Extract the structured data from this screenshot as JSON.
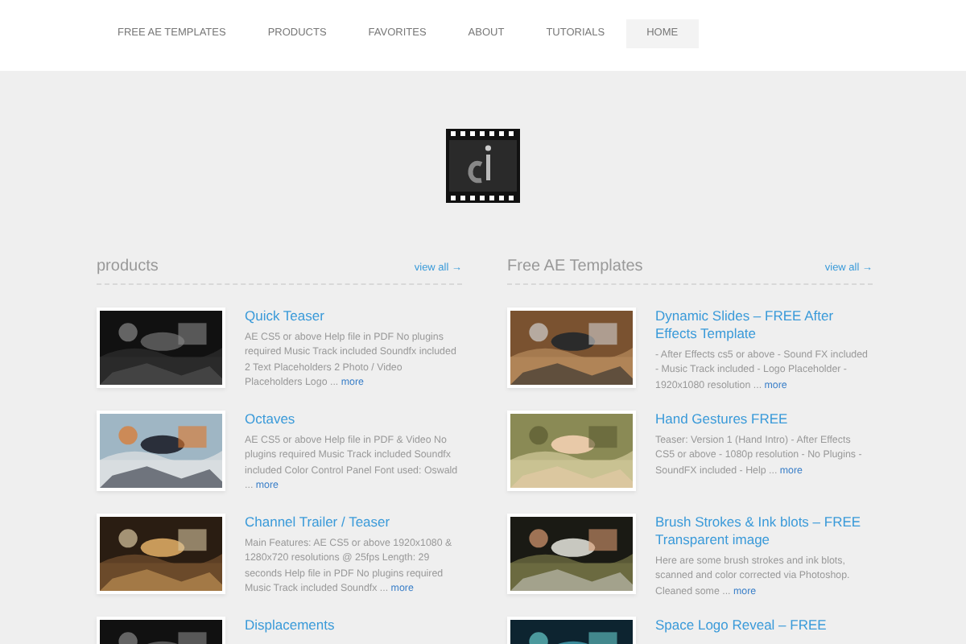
{
  "nav": [
    {
      "label": "FREE AE TEMPLATES",
      "selected": false
    },
    {
      "label": "PRODUCTS",
      "selected": false
    },
    {
      "label": "FAVORITES",
      "selected": false
    },
    {
      "label": "ABOUT",
      "selected": false
    },
    {
      "label": "TUTORIALS",
      "selected": false
    },
    {
      "label": "HOME",
      "selected": true
    }
  ],
  "sections": [
    {
      "title": "products",
      "view_all": "view all →",
      "items": [
        {
          "title": "Quick Teaser",
          "description": "AE CS5 or above Help file in PDF No plugins required Music Track included Soundfx included 2 Text Placeholders 2 Photo / Video Placeholders Logo ...",
          "more": "more"
        },
        {
          "title": "Octaves",
          "description": "AE CS5 or above Help file in PDF & Video No plugins required Music Track included Soundfx included Color Control Panel Font used: Oswald ...",
          "more": "more"
        },
        {
          "title": "Channel Trailer / Teaser",
          "description": "Main Features: AE CS5 or above 1920x1080 & 1280x720 resolutions @ 25fps Length: 29 seconds Help file in PDF No plugins required Music Track included Soundfx ...",
          "more": "more"
        },
        {
          "title": "Displacements"
        }
      ]
    },
    {
      "title": "Free AE Templates",
      "view_all": "view all →",
      "items": [
        {
          "title": "Dynamic Slides – FREE After Effects Template",
          "description": "- After Effects cs5 or above - Sound FX included - Music Track included - Logo Placeholder - 1920x1080 resolution ...",
          "more": "more"
        },
        {
          "title": "Hand Gestures FREE",
          "description": "Teaser:  Version 1 (Hand Intro) - After Effects CS5 or above - 1080p resolution - No Plugins - SoundFX included - Help ...",
          "more": "more"
        },
        {
          "title": "Brush Strokes & Ink blots – FREE Transparent image",
          "description": "Here are some brush strokes and ink blots, scanned and color corrected via Photoshop. Cleaned some ...",
          "more": "more"
        },
        {
          "title": "Space Logo Reveal – FREE"
        }
      ]
    }
  ]
}
